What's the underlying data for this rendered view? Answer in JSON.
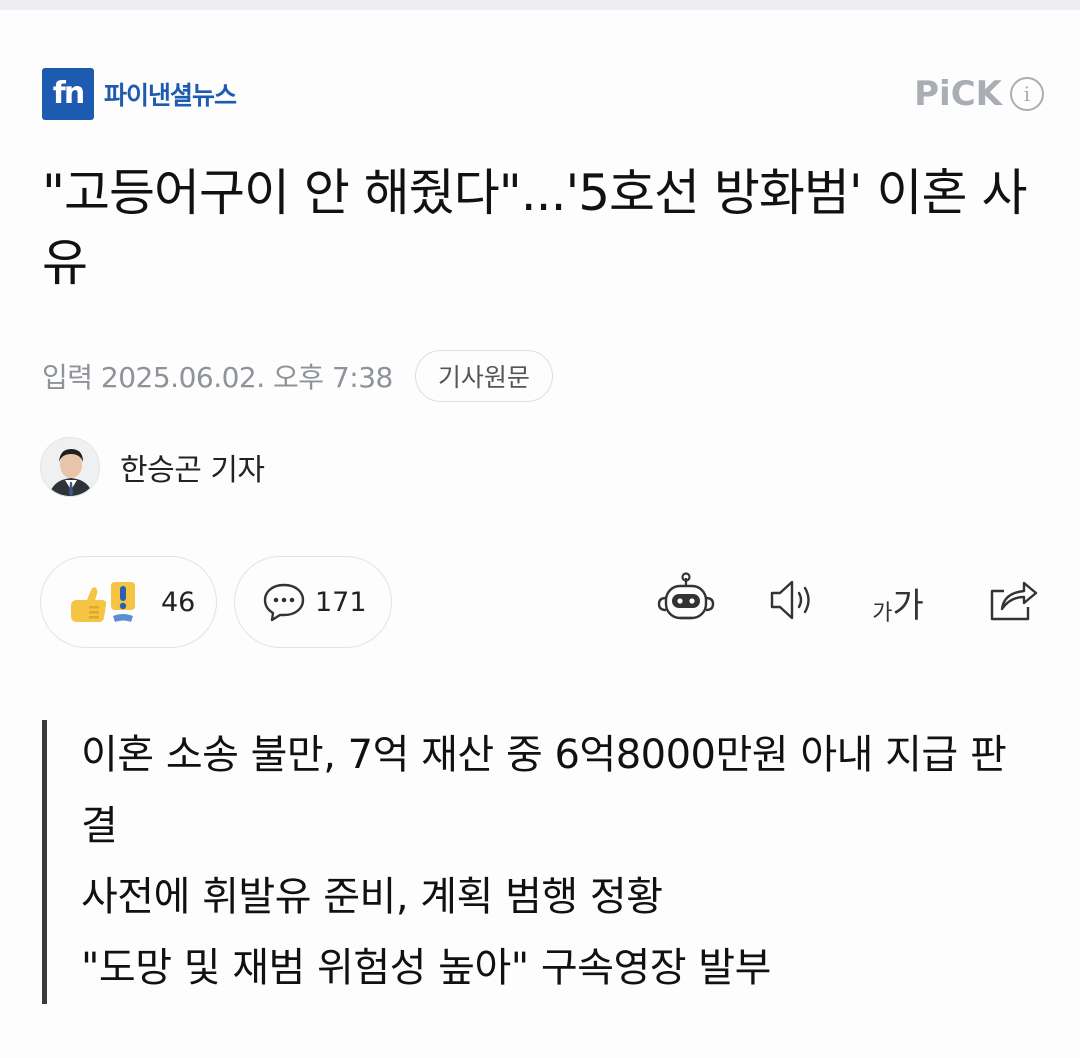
{
  "publisher": {
    "logo_mark": "fn",
    "logo_text": "파이낸셜뉴스",
    "brand_color": "#1c5bb0"
  },
  "pick": {
    "label": "PiCK",
    "info_glyph": "i"
  },
  "article": {
    "headline": "\"고등어구이 안 해줬다\"...'5호선 방화범' 이혼 사유",
    "date": "입력 2025.06.02. 오후 7:38",
    "original_button": "기사원문",
    "reporter": "한승곤 기자"
  },
  "actions": {
    "reaction_count": "46",
    "comment_count": "171",
    "icons": [
      "reaction-icon",
      "comment-icon",
      "summary-bot-icon",
      "audio-icon",
      "font-size-icon",
      "share-icon"
    ],
    "font_small": "가",
    "font_large": "가"
  },
  "summary": {
    "lines": [
      "이혼 소송 불만, 7억 재산 중 6억8000만원 아내 지급 판결",
      "사전에 휘발유 준비, 계획 범행 정황",
      "\"도망 및 재범 위험성 높아\" 구속영장 발부"
    ]
  }
}
